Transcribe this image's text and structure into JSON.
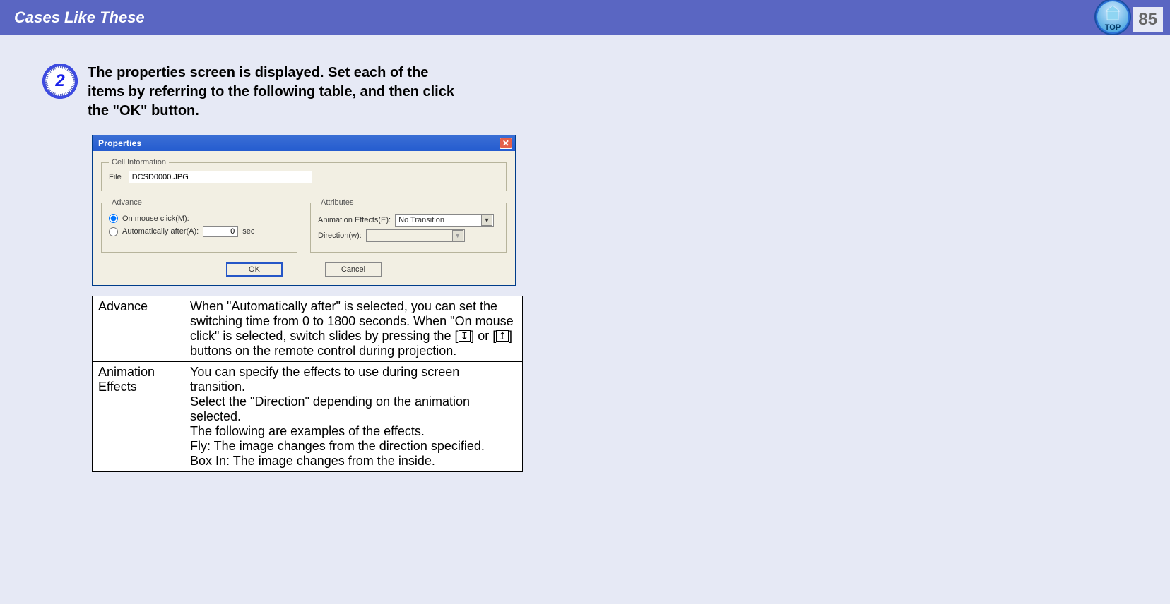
{
  "header": {
    "title": "Cases Like These",
    "page_number": "85",
    "top_label": "TOP"
  },
  "step": {
    "number": "2",
    "text": "The properties screen is displayed. Set each of the items by referring to the following table, and then click the \"OK\" button."
  },
  "dialog": {
    "title": "Properties",
    "groups": {
      "cell_info": {
        "legend": "Cell Information",
        "file_label": "File",
        "file_value": "DCSD0000.JPG"
      },
      "advance": {
        "legend": "Advance",
        "on_mouse_label": "On mouse click(M):",
        "auto_after_label": "Automatically after(A):",
        "auto_after_value": "0",
        "auto_after_unit": "sec"
      },
      "attributes": {
        "legend": "Attributes",
        "anim_effects_label": "Animation Effects(E):",
        "anim_effects_value": "No Transition",
        "direction_label": "Direction(w):",
        "direction_value": ""
      }
    },
    "buttons": {
      "ok": "OK",
      "cancel": "Cancel"
    }
  },
  "table": {
    "rows": [
      {
        "name": "Advance",
        "desc_pre": "When \"Automatically after\" is selected, you can set the switching time from 0 to 1800 seconds. When \"On mouse click\" is selected, switch slides by pressing the [",
        "key1": "↧",
        "desc_mid": "] or [",
        "key2": "↥",
        "desc_post": "] buttons on the remote control during projection."
      },
      {
        "name": "Animation Effects",
        "desc": "You can specify the effects to use during screen transition.\nSelect the \"Direction\" depending on the animation selected.\nThe following are examples of the effects.\nFly: The image changes from the direction specified.\nBox In: The image changes from the inside."
      }
    ]
  }
}
